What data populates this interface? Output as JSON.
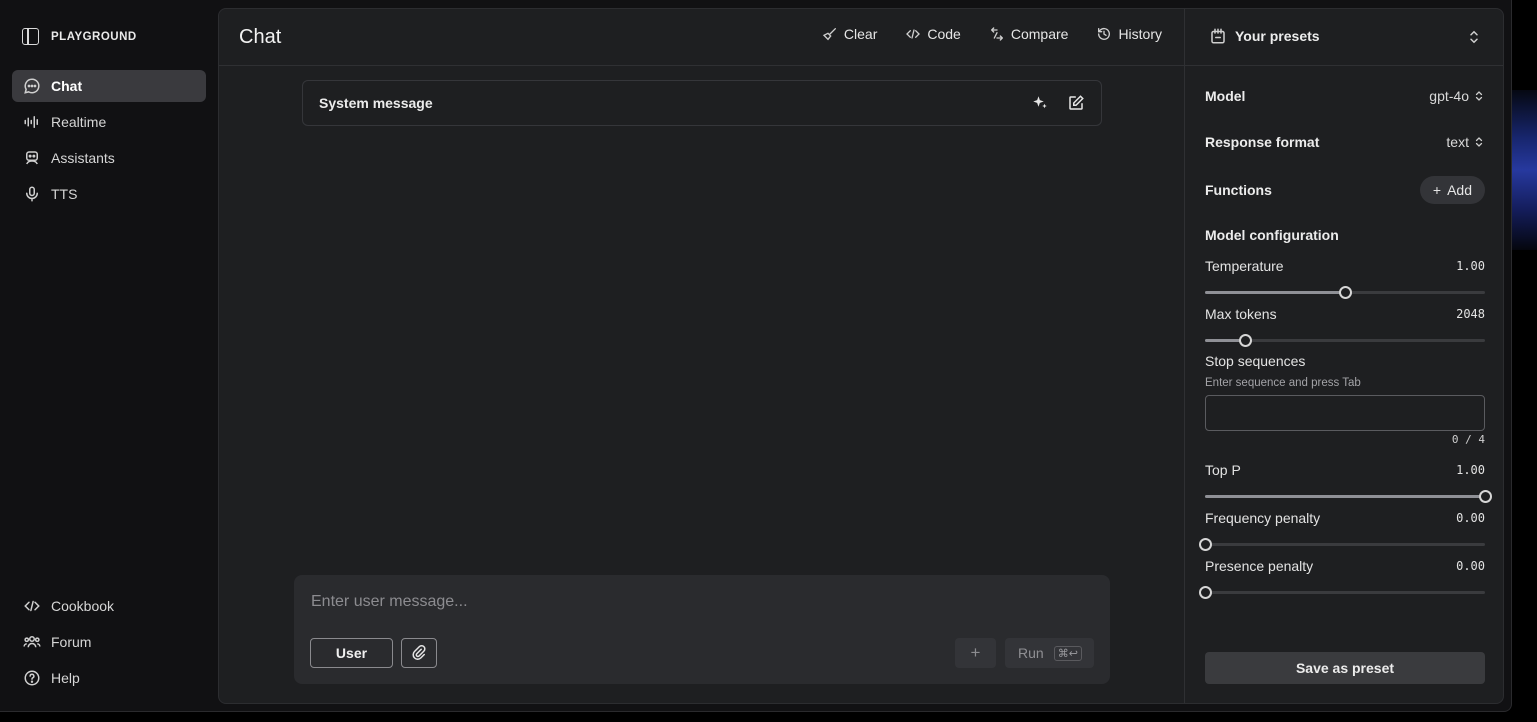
{
  "brand": {
    "name": "PLAYGROUND"
  },
  "sidebar": {
    "items": [
      {
        "label": "Chat",
        "icon": "chat-bubble-icon",
        "active": true
      },
      {
        "label": "Realtime",
        "icon": "waveform-icon"
      },
      {
        "label": "Assistants",
        "icon": "robot-icon"
      },
      {
        "label": "TTS",
        "icon": "microphone-icon"
      }
    ],
    "bottom": [
      {
        "label": "Cookbook",
        "icon": "code-icon"
      },
      {
        "label": "Forum",
        "icon": "users-icon"
      },
      {
        "label": "Help",
        "icon": "help-circle-icon"
      }
    ]
  },
  "header": {
    "title": "Chat",
    "toolbar": {
      "clear": "Clear",
      "code": "Code",
      "compare": "Compare",
      "history": "History"
    }
  },
  "system_message": {
    "label": "System message"
  },
  "composer": {
    "placeholder": "Enter user message...",
    "role": "User",
    "add": "+",
    "run": "Run",
    "shortcut": "⌘↩"
  },
  "settings": {
    "presets_label": "Your presets",
    "model": {
      "label": "Model",
      "value": "gpt-4o"
    },
    "response_format": {
      "label": "Response format",
      "value": "text"
    },
    "functions": {
      "label": "Functions",
      "add": "Add"
    },
    "config_title": "Model configuration",
    "temperature": {
      "label": "Temperature",
      "value": "1.00",
      "level": 0.5
    },
    "max_tokens": {
      "label": "Max tokens",
      "value": "2048",
      "level": 0.143
    },
    "stop_sequences": {
      "label": "Stop sequences",
      "hint": "Enter sequence and press Tab",
      "count": "0 / 4"
    },
    "top_p": {
      "label": "Top P",
      "value": "1.00",
      "level": 1.0
    },
    "frequency_penalty": {
      "label": "Frequency penalty",
      "value": "0.00",
      "level": 0.0
    },
    "presence_penalty": {
      "label": "Presence penalty",
      "value": "0.00",
      "level": 0.0
    },
    "save_preset": "Save as preset"
  },
  "colors": {
    "background": "#111113",
    "panel": "#1e1f21",
    "active_nav": "#3a3a3e"
  }
}
